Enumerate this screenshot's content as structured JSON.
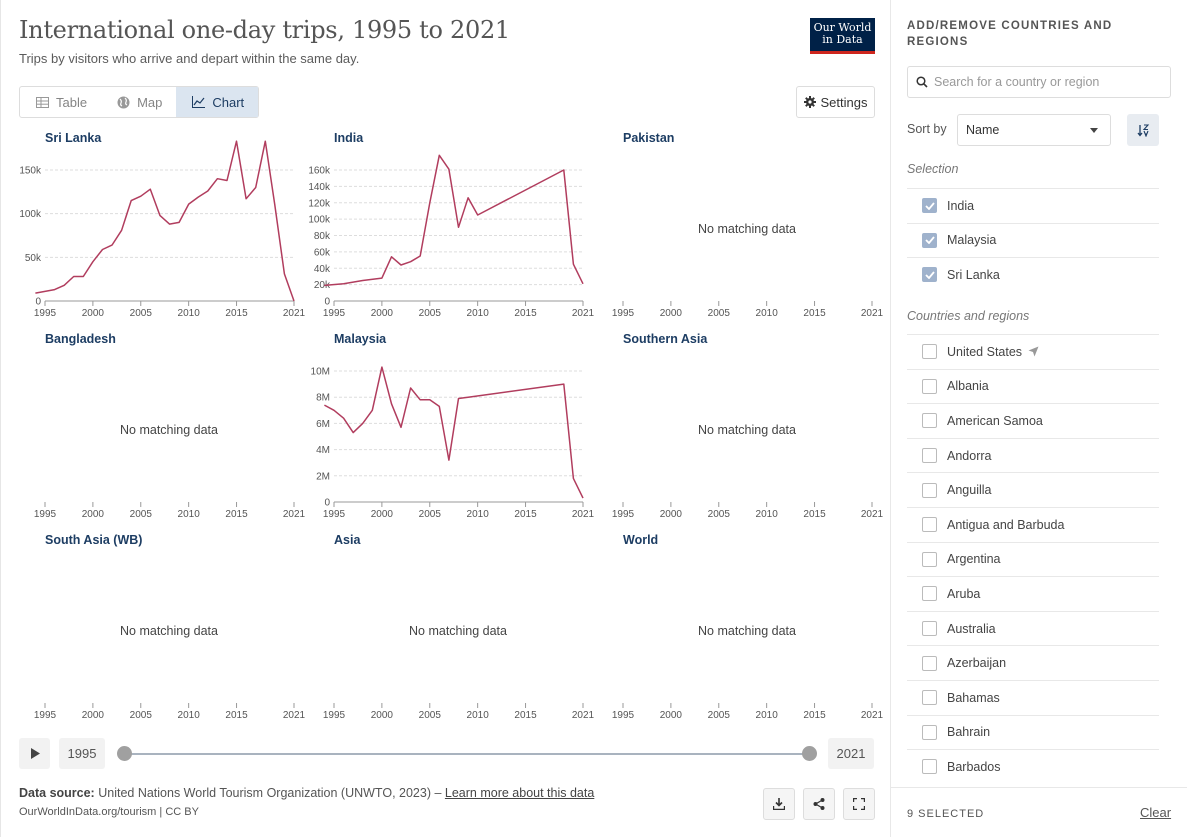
{
  "header": {
    "title": "International one-day trips, 1995 to 2021",
    "subtitle": "Trips by visitors who arrive and depart within the same day.",
    "logo_line1": "Our World",
    "logo_line2": "in Data"
  },
  "tabs": [
    {
      "label": "Table",
      "icon": "table-icon"
    },
    {
      "label": "Map",
      "icon": "globe-icon"
    },
    {
      "label": "Chart",
      "icon": "line-chart-icon",
      "active": true
    }
  ],
  "settings_label": "Settings",
  "chart_data": {
    "type": "line",
    "x_ticks": [
      "1995",
      "2000",
      "2005",
      "2010",
      "2015",
      "2021"
    ],
    "xlim": [
      1995,
      2021
    ],
    "no_data_label": "No matching data",
    "line_color": "#b13d5e",
    "facets": [
      {
        "title": "Sri Lanka",
        "y_ticks": [
          "0",
          "50k",
          "100k",
          "150k"
        ],
        "ylim": [
          0,
          150000
        ],
        "x": [
          1994,
          1996,
          1997,
          1998,
          1999,
          2000,
          2001,
          2002,
          2003,
          2004,
          2005,
          2006,
          2007,
          2008,
          2009,
          2010,
          2011,
          2012,
          2013,
          2014,
          2015,
          2016,
          2017,
          2018,
          2019,
          2020,
          2021
        ],
        "y": [
          9000,
          13000,
          18000,
          28000,
          28000,
          45000,
          59000,
          64000,
          81000,
          115000,
          120000,
          128000,
          98000,
          88000,
          90000,
          111000,
          119000,
          126000,
          140000,
          138000,
          195000,
          117000,
          130000,
          188000,
          110000,
          31000,
          0
        ]
      },
      {
        "title": "India",
        "y_ticks": [
          "0",
          "20k",
          "40k",
          "60k",
          "80k",
          "100k",
          "120k",
          "140k",
          "160k"
        ],
        "ylim": [
          0,
          160000
        ],
        "x": [
          1994,
          1996,
          1998,
          2000,
          2001,
          2002,
          2003,
          2004,
          2005,
          2006,
          2007,
          2008,
          2009,
          2010,
          2019,
          2020,
          2021
        ],
        "y": [
          19000,
          21000,
          25000,
          28000,
          54000,
          44000,
          48000,
          55000,
          120000,
          178000,
          161000,
          90000,
          126000,
          105000,
          160000,
          45000,
          21000
        ]
      },
      {
        "title": "Pakistan",
        "no_data": true
      },
      {
        "title": "Bangladesh",
        "no_data": true
      },
      {
        "title": "Malaysia",
        "y_ticks": [
          "0",
          "2M",
          "4M",
          "6M",
          "8M",
          "10M"
        ],
        "ylim": [
          0,
          10000000
        ],
        "x": [
          1994,
          1995,
          1996,
          1997,
          1998,
          1999,
          2000,
          2001,
          2002,
          2003,
          2004,
          2005,
          2006,
          2007,
          2008,
          2009,
          2019,
          2020,
          2021
        ],
        "y": [
          7400000,
          7000000,
          6400000,
          5300000,
          6000000,
          7000000,
          10300000,
          7500000,
          5700000,
          8700000,
          7800000,
          7800000,
          7300000,
          3200000,
          7900000,
          8000000,
          9000000,
          1800000,
          300000
        ]
      },
      {
        "title": "Southern Asia",
        "no_data": true
      },
      {
        "title": "South Asia (WB)",
        "no_data": true
      },
      {
        "title": "Asia",
        "no_data": true
      },
      {
        "title": "World",
        "no_data": true
      }
    ]
  },
  "timeline": {
    "start": "1995",
    "end": "2021"
  },
  "footer": {
    "source_label": "Data source:",
    "source_text": "United Nations World Tourism Organization (UNWTO, 2023) –",
    "learn_more": "Learn more about this data",
    "url": "OurWorldInData.org/tourism | CC BY"
  },
  "sidebar": {
    "title_line1": "ADD/REMOVE COUNTRIES AND",
    "title_line2": "REGIONS",
    "search_placeholder": "Search for a country or region",
    "sort_label": "Sort by",
    "sort_value": "Name",
    "selection_label": "Selection",
    "selection": [
      "India",
      "Malaysia",
      "Sri Lanka"
    ],
    "countries_label": "Countries and regions",
    "countries": [
      "United States",
      "Albania",
      "American Samoa",
      "Andorra",
      "Anguilla",
      "Antigua and Barbuda",
      "Argentina",
      "Aruba",
      "Australia",
      "Azerbaijan",
      "Bahamas",
      "Bahrain",
      "Barbados"
    ],
    "selected_count": "9 SELECTED",
    "clear_label": "Clear"
  }
}
